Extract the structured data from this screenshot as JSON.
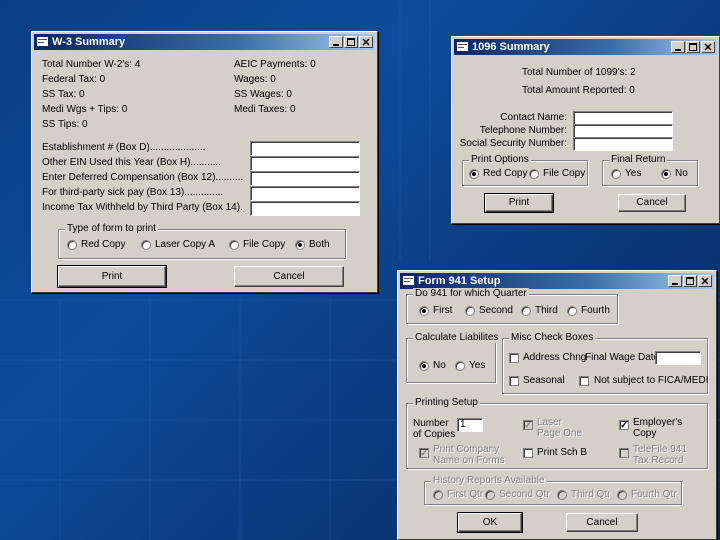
{
  "w3": {
    "title": "W-3 Summary",
    "left_lines": [
      "Total Number W-2's: 4",
      "Federal Tax: 0",
      "SS Tax: 0",
      "Medi Wgs + Tips: 0",
      "SS Tips: 0"
    ],
    "right_lines": [
      "AEIC Payments: 0",
      "Wages: 0",
      "SS Wages: 0",
      "Medi Taxes: 0"
    ],
    "fields": [
      {
        "label": "Establishment # (Box D)....................",
        "value": ""
      },
      {
        "label": "Other EIN Used this Year (Box H)...........",
        "value": ""
      },
      {
        "label": "Enter Deferred Compensation (Box 12)..........",
        "value": ""
      },
      {
        "label": "For third-party sick pay (Box 13)..............",
        "value": ""
      },
      {
        "label": "Income Tax Withheld by Third Party (Box 14).",
        "value": ""
      }
    ],
    "form_type_group": "Type of form to print",
    "form_types": [
      "Red Copy",
      "Laser Copy A",
      "File Copy",
      "Both"
    ],
    "selected_form_type": "Both",
    "print_label": "Print",
    "cancel_label": "Cancel"
  },
  "s1096": {
    "title": "1096 Summary",
    "total_line": "Total Number of 1099's: 2",
    "amount_line": "Total Amount Reported: 0",
    "fields": [
      {
        "label": "Contact Name:",
        "value": ""
      },
      {
        "label": "Telephone Number:",
        "value": ""
      },
      {
        "label": "Social Security Number:",
        "value": ""
      }
    ],
    "print_options_group": "Print Options",
    "print_options": [
      "Red Copy",
      "File Copy"
    ],
    "selected_print_option": "Red Copy",
    "final_return_group": "Final Return",
    "final_return_options": [
      "Yes",
      "No"
    ],
    "selected_final_return": "No",
    "print_label": "Print",
    "cancel_label": "Cancel"
  },
  "f941": {
    "title": "Form 941 Setup",
    "quarter_group": "Do 941 for which Quarter",
    "quarters": [
      "First",
      "Second",
      "Third",
      "Fourth"
    ],
    "selected_quarter": "First",
    "liabilities_group": "Calculate Liabilites",
    "liabilities_options": [
      "No",
      "Yes"
    ],
    "selected_liability": "No",
    "misc_group": "Misc Check Boxes",
    "misc_address": "Address Chng",
    "misc_final_wages": "Final Wage Date",
    "misc_final_wages_value": "",
    "misc_seasonal": "Seasonal",
    "misc_not_subject": "Not subject to FICA/MEDI",
    "printing_group": "Printing Setup",
    "copies_label": "Number of Copies",
    "copies_value": "1",
    "laser_page_one": "Laser Page One",
    "employers_copy": "Employer's Copy",
    "print_company_name": "Print Company Name on Forms",
    "print_sch_b": "Print Sch B",
    "telefile": "TeleFile 941 Tax Record",
    "history_group": "History Reports Available",
    "history_options": [
      "First Qtr",
      "Second Qtr",
      "Third Qtr",
      "Fourth Qtr"
    ],
    "ok_label": "OK",
    "cancel_label": "Cancel"
  },
  "colors": {
    "titlebar_start": "#0a246a",
    "titlebar_end": "#a6caf0",
    "window_face": "#d4d0c8",
    "desktop_blue": "#0d4c9c"
  }
}
